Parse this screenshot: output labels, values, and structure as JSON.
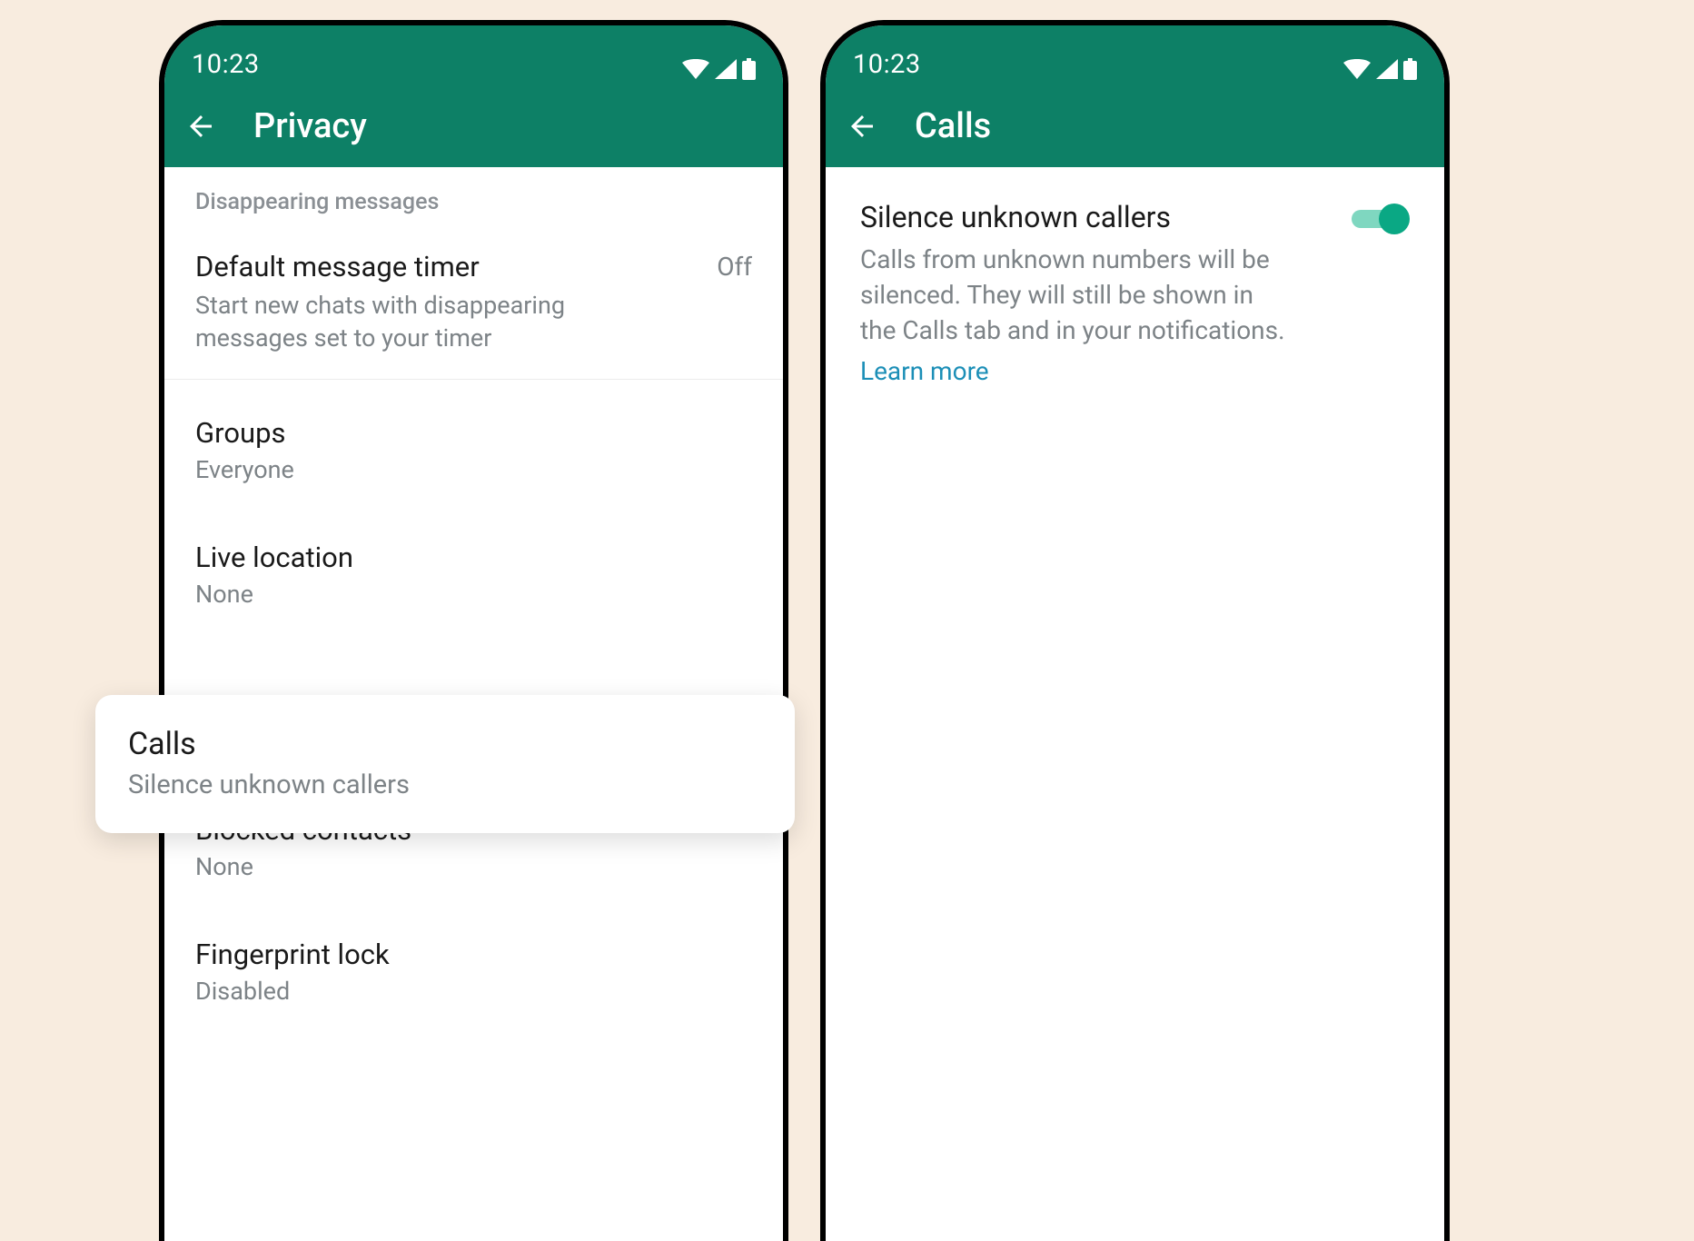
{
  "status": {
    "time": "10:23"
  },
  "colors": {
    "brand": "#0d8066",
    "accent": "#0aa884",
    "link": "#1c8fb7"
  },
  "left": {
    "title": "Privacy",
    "section_label": "Disappearing messages",
    "timer": {
      "title": "Default message timer",
      "value": "Off",
      "desc": "Start new chats with disappearing messages set to your timer"
    },
    "items": [
      {
        "title": "Groups",
        "sub": "Everyone"
      },
      {
        "title": "Live location",
        "sub": "None"
      },
      {
        "title": "Calls",
        "sub": "Silence unknown callers"
      },
      {
        "title": "Blocked contacts",
        "sub": "None"
      },
      {
        "title": "Fingerprint lock",
        "sub": "Disabled"
      }
    ]
  },
  "right": {
    "title": "Calls",
    "silence": {
      "title": "Silence unknown callers",
      "desc": "Calls from unknown numbers will be silenced. They will still be shown in the Calls tab and in your notifications.",
      "learn": "Learn more",
      "enabled": true
    }
  }
}
